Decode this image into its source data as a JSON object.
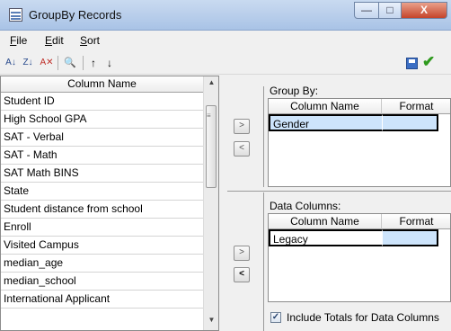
{
  "window": {
    "title": "GroupBy Records",
    "controls": {
      "minimize": "—",
      "maximize": "□",
      "close": "X"
    }
  },
  "menu": [
    {
      "label": "File",
      "mnemonic": "F",
      "rest": "ile"
    },
    {
      "label": "Edit",
      "mnemonic": "E",
      "rest": "dit"
    },
    {
      "label": "Sort",
      "mnemonic": "S",
      "rest": "ort"
    }
  ],
  "toolbar": {
    "sort_asc": "A↓",
    "sort_desc": "Z↓",
    "clear_sort": "A✕",
    "find": "🔍",
    "move_up": "↑",
    "move_down": "↓",
    "icons": [
      "sort-ascending-icon",
      "sort-descending-icon",
      "clear-sort-icon",
      "find-icon",
      "move-up-icon",
      "move-down-icon",
      "save-icon",
      "apply-check-icon"
    ]
  },
  "columns": {
    "header": "Column Name",
    "items": [
      "Student ID",
      "High School GPA",
      "SAT - Verbal",
      "SAT - Math",
      "SAT Math BINS",
      "State",
      "Student distance from school",
      "Enroll",
      "Visited Campus",
      "median_age",
      "median_school",
      "International Applicant"
    ]
  },
  "move_buttons": {
    "add": ">",
    "remove": "<"
  },
  "group_by": {
    "label": "Group By:",
    "headers": [
      "Column Name",
      "Format"
    ],
    "rows": [
      {
        "name": "Gender",
        "format": ""
      }
    ]
  },
  "data_columns": {
    "label": "Data Columns:",
    "headers": [
      "Column Name",
      "Format"
    ],
    "rows": [
      {
        "name": "Legacy",
        "format": ""
      }
    ]
  },
  "include_totals": {
    "label": "Include Totals for Data Columns",
    "checked": true,
    "mark": "✓"
  },
  "colors": {
    "selection": "#cde4fb",
    "check_green": "#2f9a1e",
    "save_blue": "#3b6ec4"
  }
}
